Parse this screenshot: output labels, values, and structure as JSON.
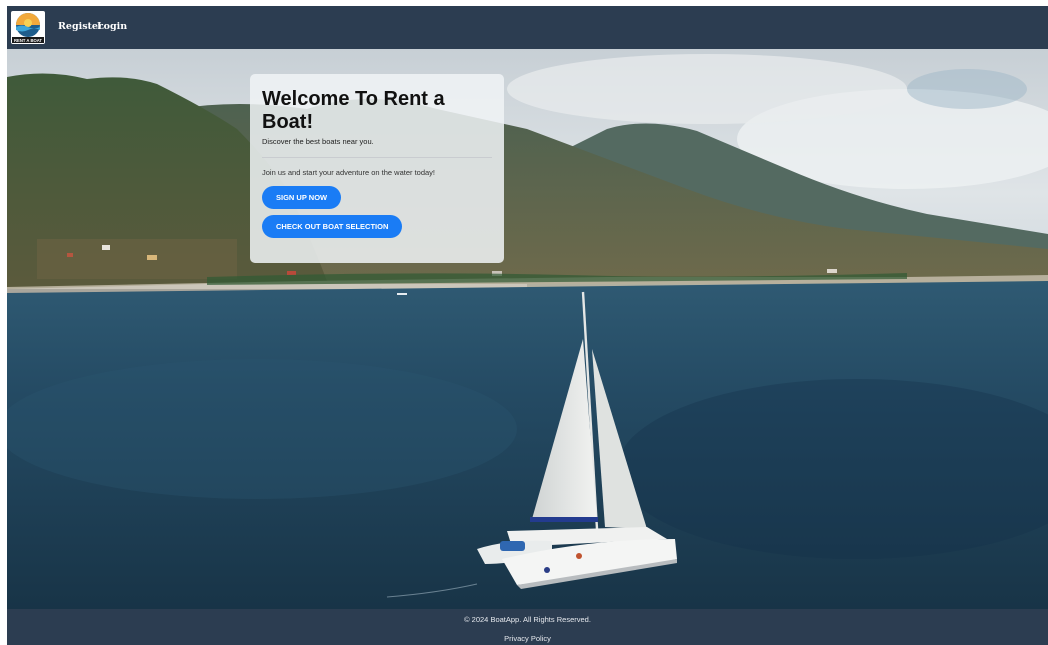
{
  "navbar": {
    "logo_text": "RENT A BOAT",
    "links": [
      {
        "label": "Register"
      },
      {
        "label": "Login"
      }
    ]
  },
  "hero": {
    "title": "Welcome To Rent a Boat!",
    "subtitle": "Discover the best boats near you.",
    "text": "Join us and start your adventure on the water today!",
    "buttons": {
      "signup": "SIGN UP NOW",
      "boats": "CHECK OUT BOAT SELECTION"
    }
  },
  "footer": {
    "copyright": "© 2024 BoatApp. All Rights Reserved.",
    "privacy": "Privacy Policy"
  },
  "colors": {
    "navbar": "#2c3d51",
    "button": "#1a7cf5",
    "sea": "#1f3f55"
  }
}
